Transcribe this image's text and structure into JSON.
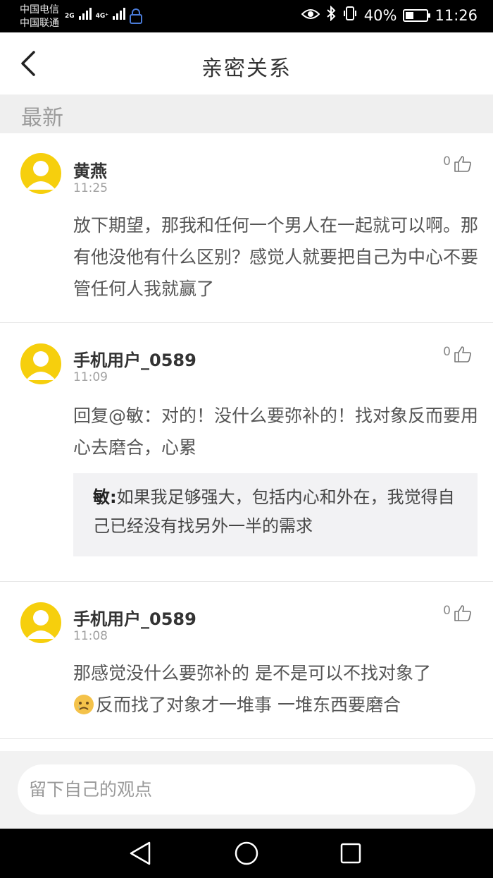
{
  "status_bar": {
    "carrier_1": "中国电信",
    "carrier_2": "中国联通",
    "net_1": "2G",
    "net_2": "4G⁺",
    "battery": "40%",
    "battery_level": 0.4,
    "time": "11:26"
  },
  "header": {
    "title": "亲密关系"
  },
  "section": {
    "label": "最新"
  },
  "comments": [
    {
      "username": "黄燕",
      "time": "11:25",
      "likes": "0",
      "text": "放下期望，那我和任何一个男人在一起就可以啊。那有他没他有什么区别？感觉人就要把自己为中心不要管任何人我就赢了"
    },
    {
      "username": "手机用户_0589",
      "time": "11:09",
      "likes": "0",
      "text": "回复@敏：对的！没什么要弥补的！找对象反而要用心去磨合，心累",
      "quote_author": "敏:",
      "quote_text": "如果我足够强大，包括内心和外在，我觉得自己已经没有找另外一半的需求"
    },
    {
      "username": "手机用户_0589",
      "time": "11:08",
      "likes": "0",
      "text_line_1": "那感觉没什么要弥补的 是不是可以不找对象了",
      "text_line_2": "反而找了对象才一堆事 一堆东西要磨合",
      "emoji": "sad-face-emoji"
    }
  ],
  "input": {
    "placeholder": "留下自己的观点"
  },
  "colors": {
    "avatar": "#f6cf0d",
    "section_bg": "#efefef",
    "quote_bg": "#f2f2f4"
  }
}
